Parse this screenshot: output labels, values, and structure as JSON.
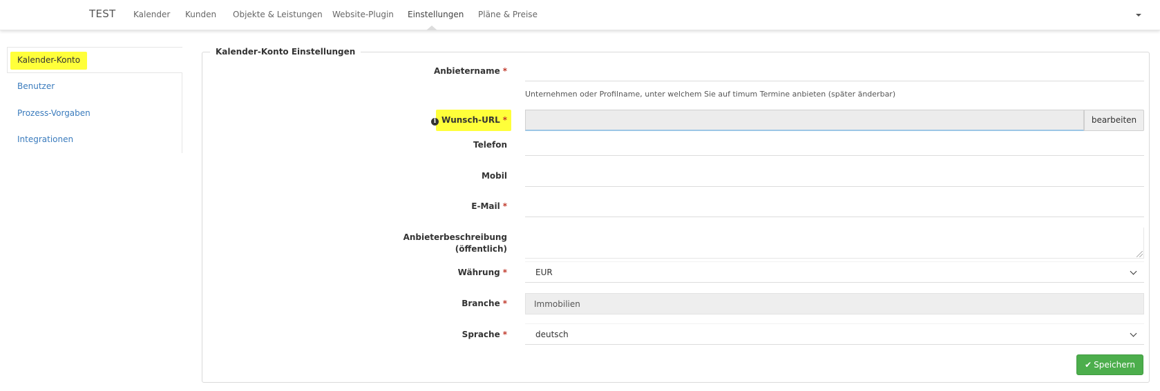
{
  "nav": {
    "brand": "TEST",
    "items": [
      "Kalender",
      "Kunden",
      "Objekte & Leistungen",
      "Website-Plugin",
      "Einstellungen",
      "Pläne & Preise"
    ],
    "active_index": 4
  },
  "sidebar": {
    "items": [
      "Kalender-Konto",
      "Benutzer",
      "Prozess-Vorgaben",
      "Integrationen"
    ],
    "active_index": 0
  },
  "form": {
    "legend": "Kalender-Konto Einstellungen",
    "required_mark": "*",
    "provider_name_label": "Anbietername",
    "provider_name_help": "Unternehmen oder Profilname, unter welchem Sie auf timum Termine anbieten (später änderbar)",
    "url_label": "Wunsch-URL",
    "url_edit_button": "bearbeiten",
    "phone_label": "Telefon",
    "mobile_label": "Mobil",
    "email_label": "E-Mail",
    "description_label_line1": "Anbieterbeschreibung",
    "description_label_line2": "(öffentlich)",
    "currency_label": "Währung",
    "currency_value": "EUR",
    "industry_label": "Branche",
    "industry_value": "Immobilien",
    "language_label": "Sprache",
    "language_value": "deutsch",
    "save_button": "Speichern"
  },
  "colors": {
    "highlight": "#ffff3a",
    "link": "#3a7bbd",
    "required": "#c0392b",
    "save_button": "#4cae4c"
  }
}
